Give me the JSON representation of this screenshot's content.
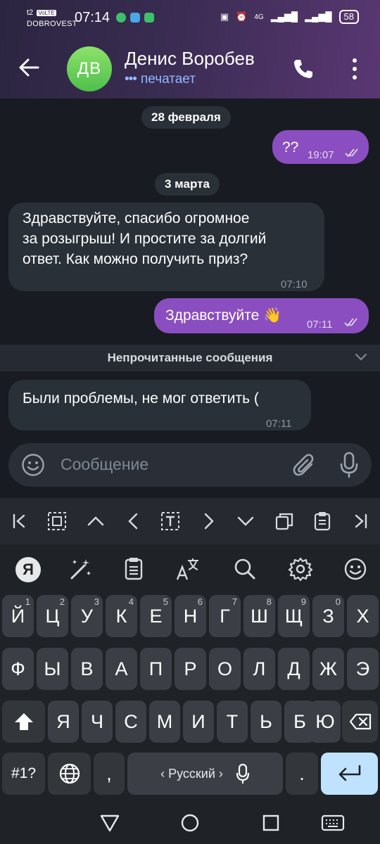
{
  "status_bar": {
    "carrier_top": "t2",
    "network_badge": "VoLTE",
    "carrier_name": "DOBROVEST",
    "time": "07:14",
    "battery": "58",
    "signal_label": "4G"
  },
  "header": {
    "avatar_initials": "ДВ",
    "contact_name": "Денис Воробев",
    "status": "печатает",
    "accent_color": "#8fb9ff",
    "avatar_color": "#5cc94f"
  },
  "chat": {
    "date_1": "28 февраля",
    "msg_1": {
      "text": "??",
      "time": "19:07",
      "direction": "out"
    },
    "date_2": "3 марта",
    "msg_2": {
      "lines": [
        "Здравствуйте, спасибо огромное",
        "за розыгрыш! И простите за долгий",
        "ответ. Как можно получить приз?"
      ],
      "time": "07:10",
      "direction": "in"
    },
    "msg_3": {
      "text": "Здравствуйте 👋",
      "time": "07:11",
      "direction": "out"
    },
    "unread_label": "Непрочитанные сообщения",
    "msg_4": {
      "text": "Были проблемы, не мог ответить (",
      "time": "07:11",
      "direction": "in"
    },
    "outgoing_color": "#8a4ec0"
  },
  "composer": {
    "placeholder": "Сообщение"
  },
  "keyboard": {
    "row1": [
      {
        "k": "Й",
        "n": "1"
      },
      {
        "k": "Ц",
        "n": "2"
      },
      {
        "k": "У",
        "n": "3"
      },
      {
        "k": "К",
        "n": "4"
      },
      {
        "k": "Е",
        "n": "5"
      },
      {
        "k": "Н",
        "n": "6"
      },
      {
        "k": "Г",
        "n": "7"
      },
      {
        "k": "Ш",
        "n": "8"
      },
      {
        "k": "Щ",
        "n": "9"
      },
      {
        "k": "З",
        "n": "0"
      },
      {
        "k": "Х",
        "n": ""
      }
    ],
    "row2": [
      "Ф",
      "Ы",
      "В",
      "А",
      "П",
      "Р",
      "О",
      "Л",
      "Д",
      "Ж",
      "Э"
    ],
    "row3": [
      "Я",
      "Ч",
      "С",
      "М",
      "И",
      "Т",
      "Ь",
      "Б",
      "Ю"
    ],
    "symbols_key": "#1?",
    "comma_key": ",",
    "space_label": "Русский",
    "period_key": ".",
    "yandex_label": "Я"
  }
}
